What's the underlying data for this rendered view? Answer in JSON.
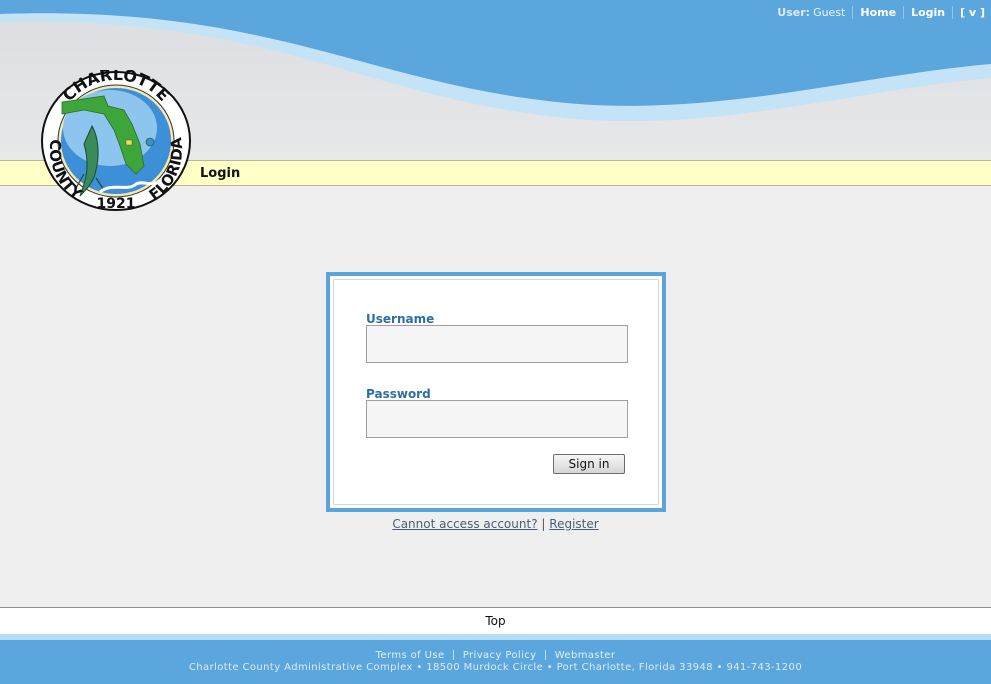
{
  "header": {
    "user_label": "User:",
    "user_value": "Guest",
    "nav": [
      "Home",
      "Login",
      "[ v ]"
    ]
  },
  "logo": {
    "text_top": "CHARLOTTE",
    "text_left": "COUNTY",
    "text_right": "FLORIDA",
    "year": "1921"
  },
  "page": {
    "title": "Login"
  },
  "form": {
    "username_label": "Username",
    "username_value": "",
    "password_label": "Password",
    "password_value": "",
    "signin_label": "Sign in"
  },
  "links": {
    "cannot_access": "Cannot access account?",
    "separator": "|",
    "register": "Register"
  },
  "top_link": "Top",
  "footer": {
    "terms": "Terms of Use",
    "privacy": "Privacy Policy",
    "webmaster": "Webmaster",
    "address": "Charlotte County Administrative Complex • 18500 Murdock Circle • Port Charlotte, Florida 33948 • 941-743-1200"
  },
  "colors": {
    "header_blue": "#5ba6dd",
    "wave_light": "#c4e3f7",
    "title_bar": "#ffffc8",
    "label_blue": "#2c6ea8",
    "box_border": "#5aa3dc"
  }
}
